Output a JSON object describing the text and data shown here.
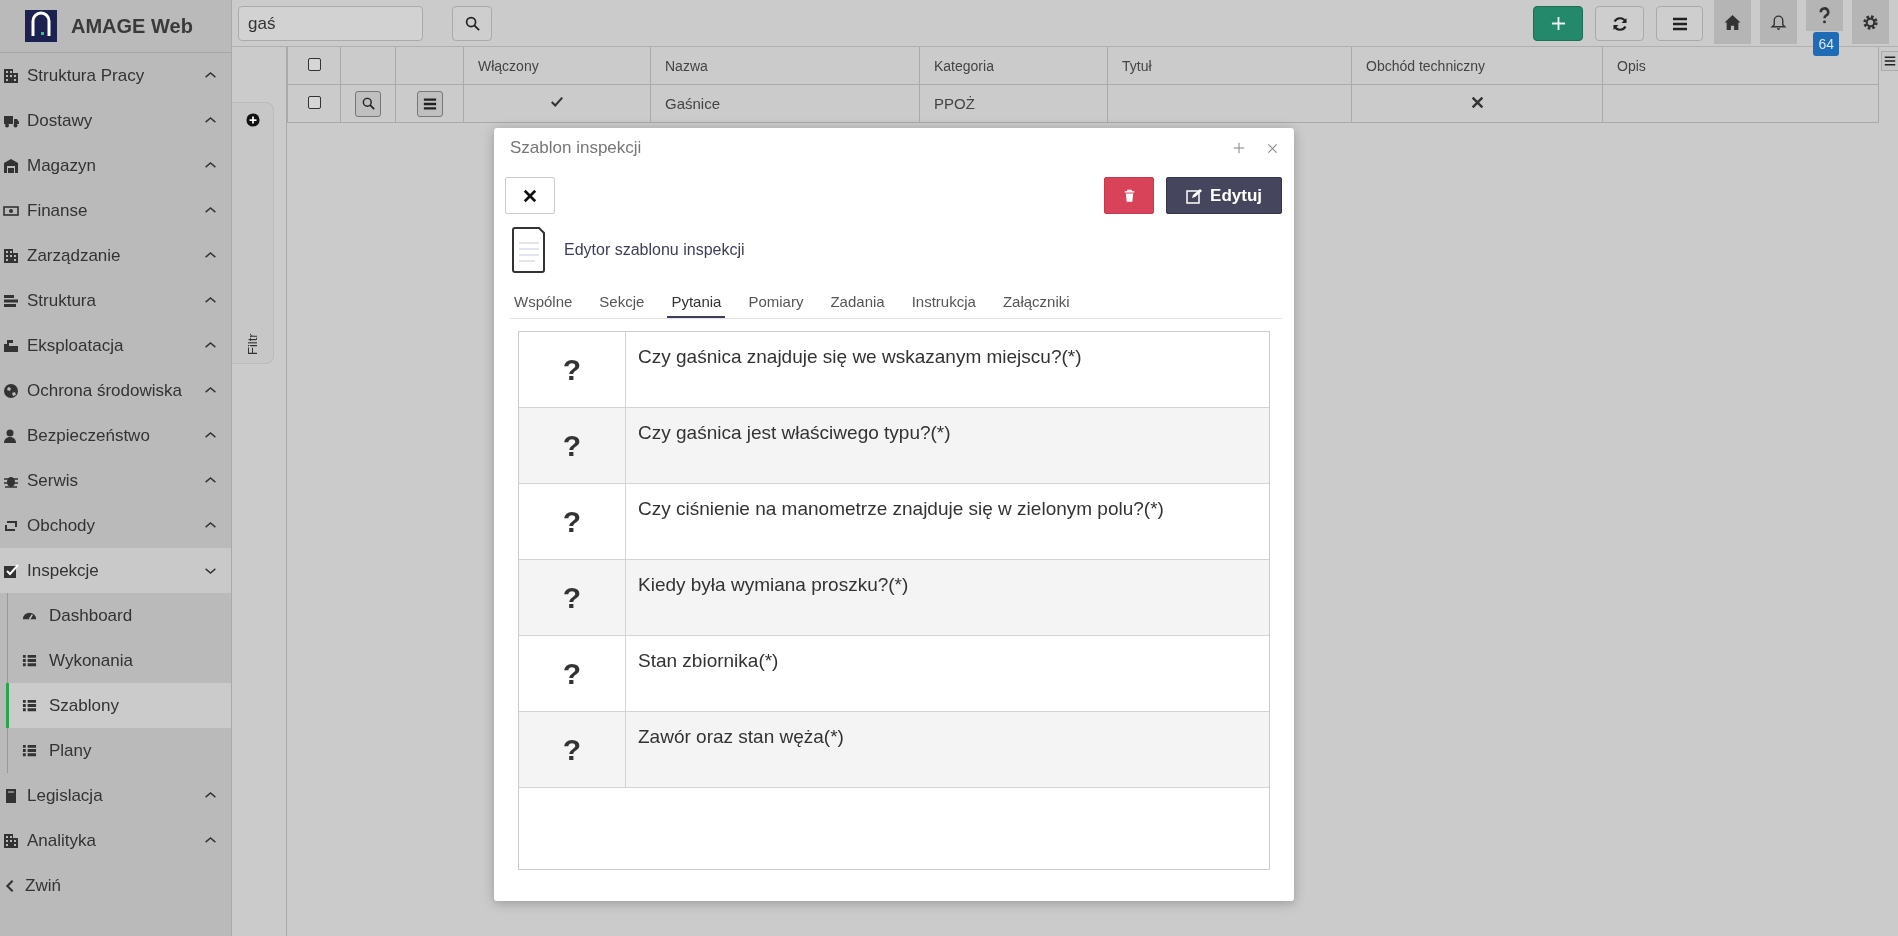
{
  "app": {
    "name": "AMAGE Web"
  },
  "sidebar": {
    "items": [
      {
        "label": "Struktura Pracy",
        "kind": "building",
        "expanded": false
      },
      {
        "label": "Dostawy",
        "kind": "truck",
        "expanded": false
      },
      {
        "label": "Magazyn",
        "kind": "store",
        "expanded": false
      },
      {
        "label": "Finanse",
        "kind": "money",
        "expanded": false
      },
      {
        "label": "Zarządzanie",
        "kind": "building",
        "expanded": false
      },
      {
        "label": "Struktura",
        "kind": "layers",
        "expanded": false
      },
      {
        "label": "Eksploatacja",
        "kind": "machine",
        "expanded": false
      },
      {
        "label": "Ochrona środowiska",
        "kind": "globe",
        "expanded": false
      },
      {
        "label": "Bezpieczeństwo",
        "kind": "user",
        "expanded": false
      },
      {
        "label": "Serwis",
        "kind": "bug",
        "expanded": false
      },
      {
        "label": "Obchody",
        "kind": "loop",
        "expanded": false
      },
      {
        "label": "Inspekcje",
        "kind": "check",
        "expanded": true,
        "children": [
          {
            "label": "Dashboard",
            "kind": "gauge",
            "selected": false
          },
          {
            "label": "Wykonania",
            "kind": "list",
            "selected": false
          },
          {
            "label": "Szablony",
            "kind": "list",
            "selected": true
          },
          {
            "label": "Plany",
            "kind": "list",
            "selected": false
          }
        ]
      },
      {
        "label": "Legislacja",
        "kind": "book",
        "expanded": false
      },
      {
        "label": "Analityka",
        "kind": "building",
        "expanded": false
      }
    ],
    "collapse": "Zwiń"
  },
  "toolbar": {
    "search": {
      "value": "gaś"
    },
    "help_badge": "64"
  },
  "filter": {
    "label": "Filtr"
  },
  "grid": {
    "all_checked": false,
    "columns": [
      "Włączony",
      "Nazwa",
      "Kategoria",
      "Tytuł",
      "Obchód techniczny",
      "Opis"
    ],
    "rows": [
      {
        "checked": false,
        "enabled": true,
        "name": "Gaśnice",
        "category": "PPOŻ",
        "technical": false
      }
    ]
  },
  "dialog": {
    "title": "Szablon inspekcji",
    "edit_button": "Edytuj",
    "subtitle": "Edytor szablonu inspekcji",
    "tabs": [
      {
        "label": "Wspólne",
        "selected": false
      },
      {
        "label": "Sekcje",
        "selected": false
      },
      {
        "label": "Pytania",
        "selected": true
      },
      {
        "label": "Pomiary",
        "selected": false
      },
      {
        "label": "Zadania",
        "selected": false
      },
      {
        "label": "Instrukcja",
        "selected": false
      },
      {
        "label": "Załączniki",
        "selected": false
      }
    ],
    "questions": [
      {
        "icon": "?",
        "text": "Czy gaśnica znajduje się we wskazanym miejscu?(*)"
      },
      {
        "icon": "?",
        "text": "Czy gaśnica jest właściwego typu?(*)"
      },
      {
        "icon": "?",
        "text": "Czy ciśnienie na manometrze znajduje się w zielonym polu?(*)"
      },
      {
        "icon": "?",
        "text": "Kiedy była wymiana proszku?(*)"
      },
      {
        "icon": "?",
        "text": "Stan zbiornika(*)"
      },
      {
        "icon": "?",
        "text": "Zawór oraz stan węża(*)"
      }
    ]
  }
}
